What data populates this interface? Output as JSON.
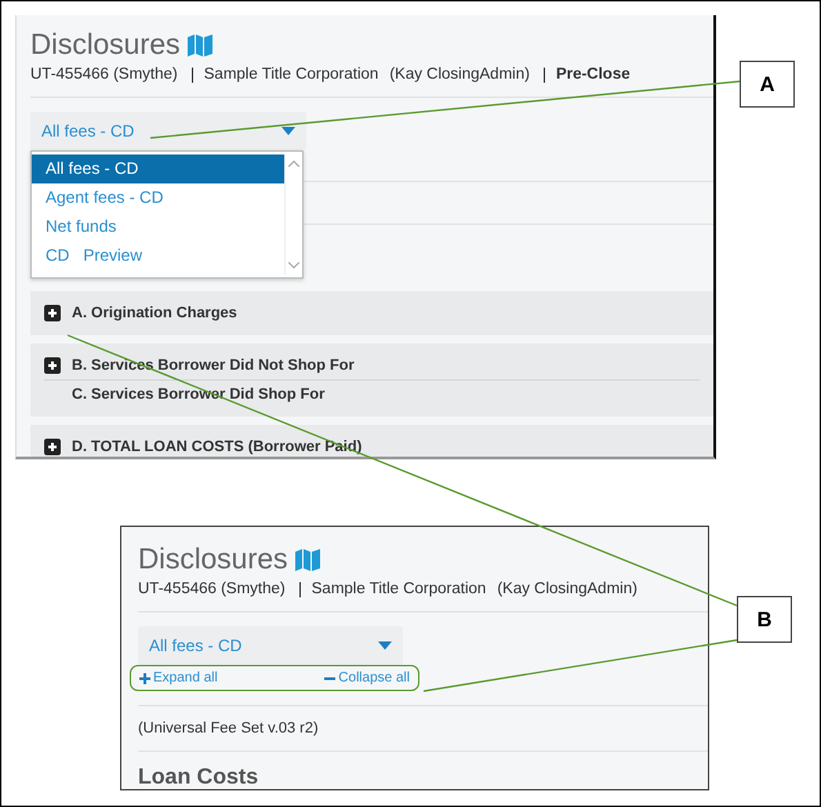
{
  "screenshot_top": {
    "title": "Disclosures",
    "file_info": [
      {
        "text": "UT-455466 (Smythe)",
        "divider_before": false,
        "bold": false
      },
      {
        "text": "Sample Title Corporation",
        "divider_before": true,
        "bold": false
      },
      {
        "text": "(Kay ClosingAdmin)",
        "divider_before": false,
        "bold": false
      },
      {
        "text": "Pre-Close",
        "divider_before": true,
        "bold": true
      }
    ],
    "fee_select": "All fees - CD",
    "dropdown_options": [
      {
        "label": "All fees - CD",
        "selected": true
      },
      {
        "label": "Agent fees - CD",
        "selected": false
      },
      {
        "label": "Net funds",
        "selected": false
      },
      {
        "label": "CD   Preview",
        "selected": false
      }
    ],
    "section_groups": [
      {
        "rows": [
          {
            "label": "A. Origination Charges",
            "toggle": true
          }
        ]
      },
      {
        "rows": [
          {
            "label": "B. Services Borrower Did Not Shop For",
            "toggle": true
          },
          {
            "label": "C. Services Borrower Did Shop For",
            "toggle": false
          }
        ]
      },
      {
        "rows": [
          {
            "label": "D. TOTAL LOAN COSTS (Borrower Paid)",
            "toggle": true
          }
        ]
      }
    ]
  },
  "screenshot_bottom": {
    "title": "Disclosures",
    "file_info": [
      {
        "text": "UT-455466 (Smythe)",
        "divider_before": false,
        "bold": false
      },
      {
        "text": "Sample Title Corporation",
        "divider_before": true,
        "bold": false
      },
      {
        "text": "(Kay ClosingAdmin)",
        "divider_before": false,
        "bold": false
      }
    ],
    "fee_select": "All fees - CD",
    "expand_all": "Expand all",
    "collapse_all": "Collapse all",
    "fee_set": "(Universal Fee Set v.03 r2)",
    "section_heading": "Loan Costs"
  },
  "callouts": [
    {
      "label": "A"
    },
    {
      "label": "B"
    }
  ]
}
